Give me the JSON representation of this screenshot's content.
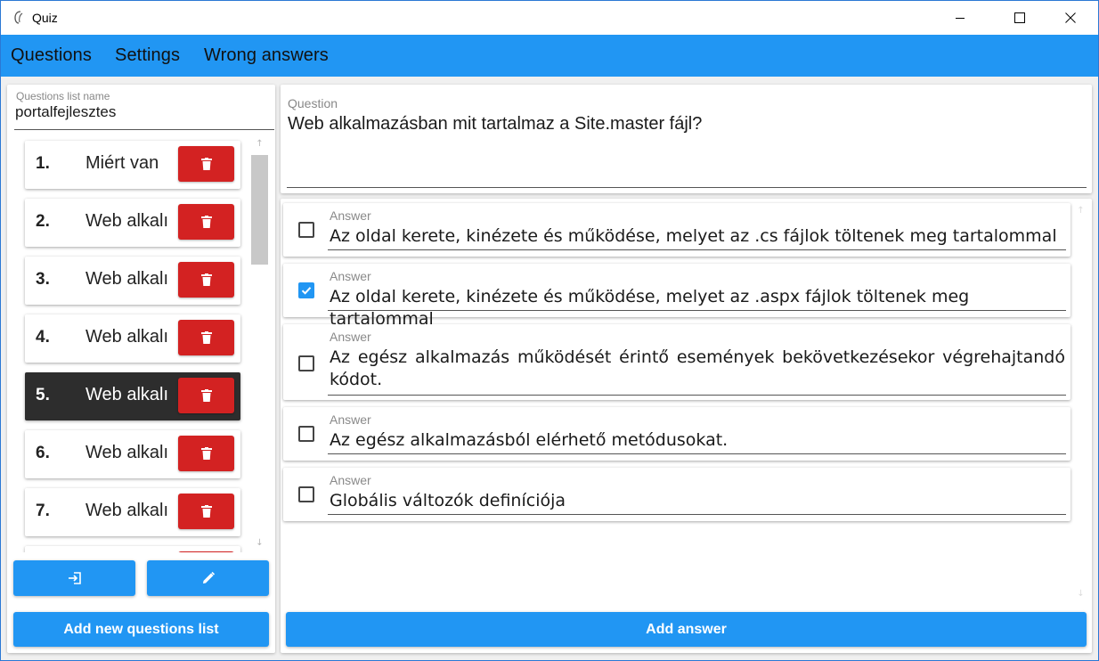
{
  "window": {
    "title": "Quiz",
    "accent_color": "#2196f3",
    "delete_color": "#d32222",
    "selected_card_color": "#2d2d2d"
  },
  "menu": {
    "items": [
      "Questions",
      "Settings",
      "Wrong answers"
    ]
  },
  "sidebar": {
    "list_name_label": "Questions list name",
    "list_name_value": "portalfejlesztes",
    "questions": [
      {
        "num": "1.",
        "text": "Miért van"
      },
      {
        "num": "2.",
        "text": "Web alkalı"
      },
      {
        "num": "3.",
        "text": "Web alkalı"
      },
      {
        "num": "4.",
        "text": "Web alkalı"
      },
      {
        "num": "5.",
        "text": "Web alkalı",
        "selected": true
      },
      {
        "num": "6.",
        "text": "Web alkalı"
      },
      {
        "num": "7.",
        "text": "Web alkalı"
      },
      {
        "num": "",
        "text": ""
      }
    ],
    "delete_icon": "trash-icon",
    "import_icon": "login-icon",
    "edit_icon": "pencil-icon",
    "add_list_label": "Add new questions list"
  },
  "question": {
    "label": "Question",
    "text": "Web alkalmazásban mit tartalmaz a Site.master fájl?"
  },
  "answers": {
    "items": [
      {
        "label": "Answer",
        "text": "Az oldal kerete, kinézete és működése, melyet az .cs fájlok töltenek meg tartalommal",
        "checked": false
      },
      {
        "label": "Answer",
        "text": "Az oldal kerete, kinézete és működése, melyet az .aspx fájlok töltenek meg tartalommal",
        "checked": true
      },
      {
        "label": "Answer",
        "text": "Az egész alkalmazás működését érintő események bekövetkezésekor végrehajtandó kódot.",
        "checked": false
      },
      {
        "label": "Answer",
        "text": "Az egész alkalmazásból elérhető metódusokat.",
        "checked": false
      },
      {
        "label": "Answer",
        "text": "Globális változók definíciója",
        "checked": false
      }
    ],
    "add_answer_label": "Add answer"
  }
}
